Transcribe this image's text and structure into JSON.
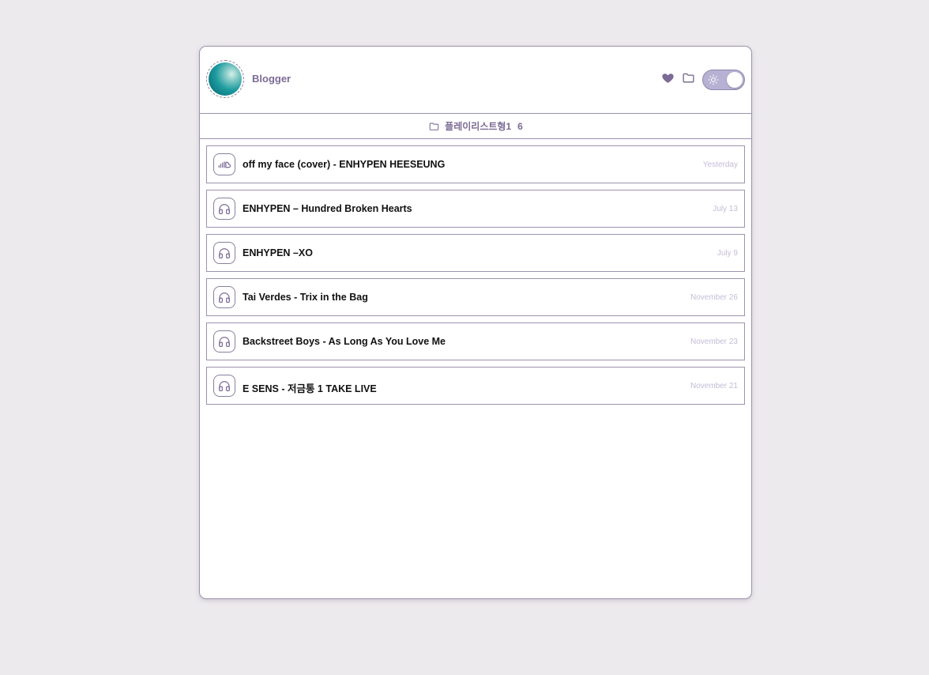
{
  "header": {
    "blogger_name": "Blogger",
    "icons": {
      "like": "heart-icon",
      "folder": "folder-icon",
      "theme_toggle": "sun-icon"
    },
    "theme_toggle_on": true
  },
  "playlist": {
    "name": "플레이리스트형1",
    "count": "6"
  },
  "tracks": [
    {
      "title": "off my face (cover) - ENHYPEN HEESEUNG",
      "date": "Yesterday",
      "icon": "soundcloud-icon"
    },
    {
      "title": "ENHYPEN – Hundred Broken Hearts",
      "date": "July 13",
      "icon": "headphones-icon"
    },
    {
      "title": "ENHYPEN –XO",
      "date": "July 9",
      "icon": "headphones-icon"
    },
    {
      "title": "Tai Verdes - Trix in the Bag",
      "date": "November 26",
      "icon": "headphones-icon"
    },
    {
      "title": "Backstreet Boys - As Long As You Love Me",
      "date": "November 23",
      "icon": "headphones-icon"
    },
    {
      "title": "E SENS - 저금통 1 TAKE LIVE",
      "date": "November 21",
      "icon": "headphones-icon"
    }
  ],
  "colors": {
    "accent": "#7c6b96",
    "border": "#9d93ad",
    "date_text": "#c4bcd8",
    "toggle_bg": "#b7b1d3",
    "page_bg": "#eceaec"
  }
}
